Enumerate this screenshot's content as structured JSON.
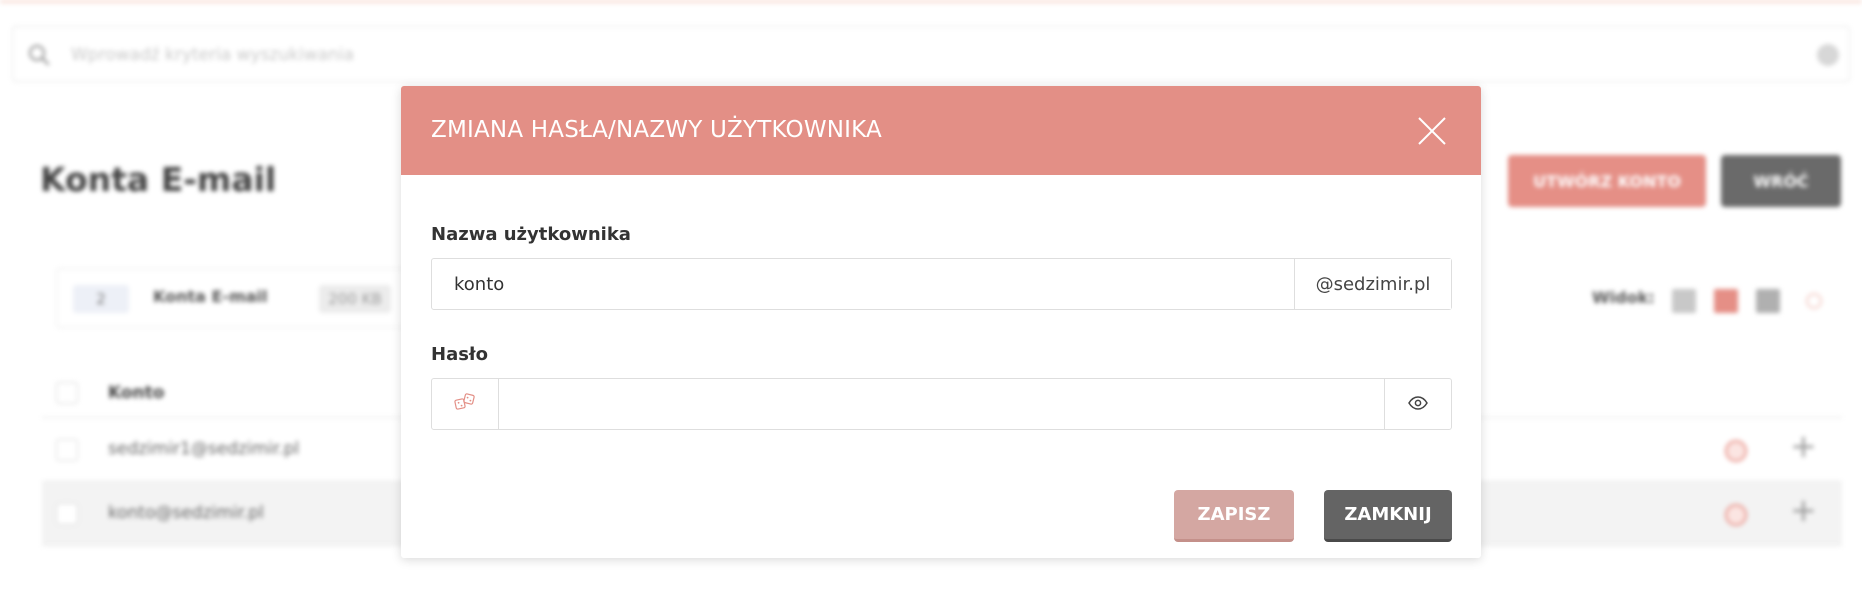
{
  "background": {
    "search": {
      "placeholder": "Wprowadź kryteria wyszukiwania"
    },
    "page_title": "Konta E-mail",
    "buttons": {
      "create_account": "UTWÓRZ KONTO",
      "back": "WRÓĆ"
    },
    "stats": {
      "count": "2",
      "label": "Konta E-mail",
      "size": "200 KB"
    },
    "view_label": "Widok:",
    "table": {
      "column_account": "Konto",
      "rows": [
        {
          "email": "sedzimir1@sedzimir.pl"
        },
        {
          "email": "konto@sedzimir.pl"
        }
      ]
    }
  },
  "modal": {
    "title": "ZMIANA HASŁA/NAZWY UŻYTKOWNIKA",
    "username_label": "Nazwa użytkownika",
    "username_value": "konto",
    "domain_suffix": "@sedzimir.pl",
    "password_label": "Hasło",
    "password_value": "",
    "save_label": "ZAPISZ",
    "close_label": "ZAMKNIJ"
  },
  "colors": {
    "accent": "#e38f86",
    "save_button": "#d4a7a2",
    "close_button": "#646464"
  },
  "icons": {
    "close": "close-icon",
    "generate": "dice-icon",
    "reveal": "eye-icon",
    "search": "search-icon"
  }
}
